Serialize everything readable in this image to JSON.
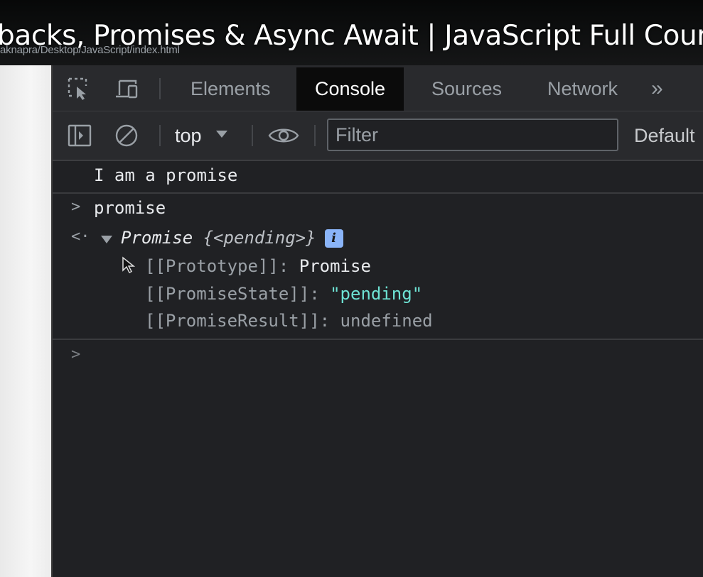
{
  "window": {
    "video_title": "backs, Promises & Async Await | JavaScript Full Cour",
    "url_fragment": "aknapra/Desktop/JavaScript/index.html"
  },
  "devtools": {
    "tabs": [
      {
        "label": "Elements",
        "active": false
      },
      {
        "label": "Console",
        "active": true
      },
      {
        "label": "Sources",
        "active": false
      },
      {
        "label": "Network",
        "active": false
      }
    ],
    "more_tabs": "»",
    "toolbar": {
      "context": "top",
      "filter_placeholder": "Filter",
      "filter_value": "",
      "levels_label": "Default"
    }
  },
  "console": {
    "log_message": "I am a promise",
    "input_command": "promise",
    "input_prompt": ">",
    "result_prompt": "<·",
    "result": {
      "head_name": "Promise ",
      "head_open": "{",
      "head_state": "<pending>",
      "head_close": "}",
      "info_badge": "i",
      "properties": [
        {
          "key": "[[Prototype]]",
          "sep": ": ",
          "value": "Promise",
          "value_type": "object"
        },
        {
          "key": "[[PromiseState]]",
          "sep": ": ",
          "value": "\"pending\"",
          "value_type": "string"
        },
        {
          "key": "[[PromiseResult]]",
          "sep": ": ",
          "value": "undefined",
          "value_type": "undefined"
        }
      ]
    },
    "empty_prompt": ">"
  },
  "colors": {
    "accent_blue": "#8ab4f8",
    "string_teal": "#6ee3d4",
    "panel_bg": "#202124",
    "toolbar_bg": "#292a2d"
  }
}
